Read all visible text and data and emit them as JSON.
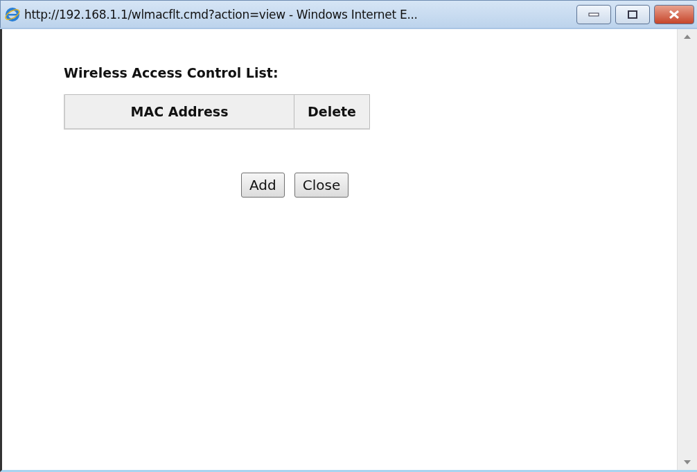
{
  "window": {
    "title": "http://192.168.1.1/wlmacflt.cmd?action=view - Windows Internet E..."
  },
  "heading": "Wireless Access Control List:",
  "table": {
    "columns": [
      "MAC Address",
      "Delete"
    ]
  },
  "buttons": [
    "Add",
    "Close"
  ]
}
